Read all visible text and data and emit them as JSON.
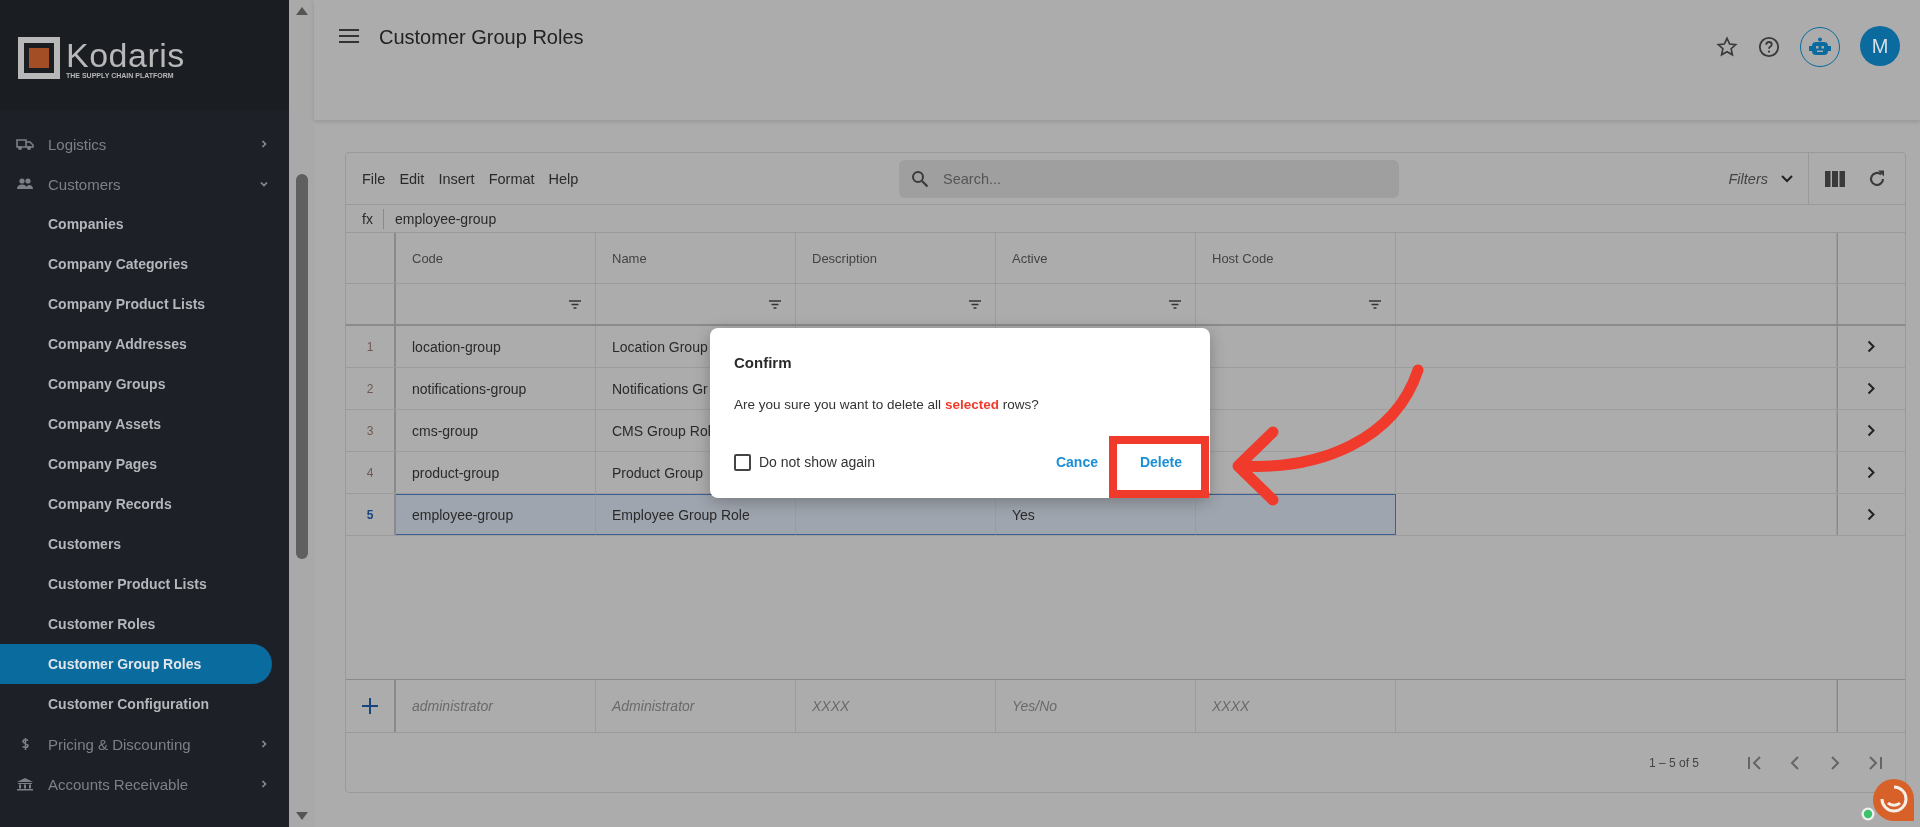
{
  "brand": {
    "name": "Kodaris",
    "tagline": "THE SUPPLY CHAIN PLATFORM"
  },
  "sidebar": {
    "items": [
      {
        "label": "Logistics",
        "kind": "truck",
        "expanded": false
      },
      {
        "label": "Customers",
        "kind": "people",
        "expanded": true,
        "children": [
          {
            "label": "Companies",
            "selected": false
          },
          {
            "label": "Company Categories",
            "selected": false
          },
          {
            "label": "Company Product Lists",
            "selected": false
          },
          {
            "label": "Company Addresses",
            "selected": false
          },
          {
            "label": "Company Groups",
            "selected": false
          },
          {
            "label": "Company Assets",
            "selected": false
          },
          {
            "label": "Company Pages",
            "selected": false
          },
          {
            "label": "Company Records",
            "selected": false
          },
          {
            "label": "Customers",
            "selected": false
          },
          {
            "label": "Customer Product Lists",
            "selected": false
          },
          {
            "label": "Customer Roles",
            "selected": false
          },
          {
            "label": "Customer Group Roles",
            "selected": true
          },
          {
            "label": "Customer Configuration",
            "selected": false
          }
        ]
      },
      {
        "label": "Pricing & Discounting",
        "kind": "dollar",
        "expanded": false
      },
      {
        "label": "Accounts Receivable",
        "kind": "bank",
        "expanded": false
      }
    ]
  },
  "header": {
    "title": "Customer Group Roles",
    "avatar": "M"
  },
  "toolbar": {
    "menus": [
      "File",
      "Edit",
      "Insert",
      "Format",
      "Help"
    ],
    "search": {
      "placeholder": "Search..."
    },
    "filters": "Filters"
  },
  "formula_bar": {
    "label": "fx",
    "value": "employee-group"
  },
  "table": {
    "columns": [
      "Code",
      "Name",
      "Description",
      "Active",
      "Host Code"
    ],
    "rows": [
      {
        "number": "1",
        "cells": [
          "location-group",
          "Location Group",
          "",
          "",
          ""
        ],
        "selected": false
      },
      {
        "number": "2",
        "cells": [
          "notifications-group",
          "Notifications Gr",
          "",
          "",
          ""
        ],
        "selected": false
      },
      {
        "number": "3",
        "cells": [
          "cms-group",
          "CMS Group Rol",
          "",
          "",
          ""
        ],
        "selected": false
      },
      {
        "number": "4",
        "cells": [
          "product-group",
          "Product Group",
          "",
          "",
          ""
        ],
        "selected": false
      },
      {
        "number": "5",
        "cells": [
          "employee-group",
          "Employee Group Role",
          "",
          "Yes",
          ""
        ],
        "selected": true
      }
    ],
    "new_row": {
      "placeholders": [
        "administrator",
        "Administrator",
        "XXXX",
        "Yes/No",
        "XXXX"
      ]
    },
    "pagination": "1 – 5 of 5"
  },
  "dialog": {
    "title": "Confirm",
    "message": "Are you sure you want to delete all **selected** rows?",
    "checkbox": {
      "label": "Do not show again",
      "checked": false
    },
    "buttons": [
      "Cance",
      "Delete"
    ]
  }
}
